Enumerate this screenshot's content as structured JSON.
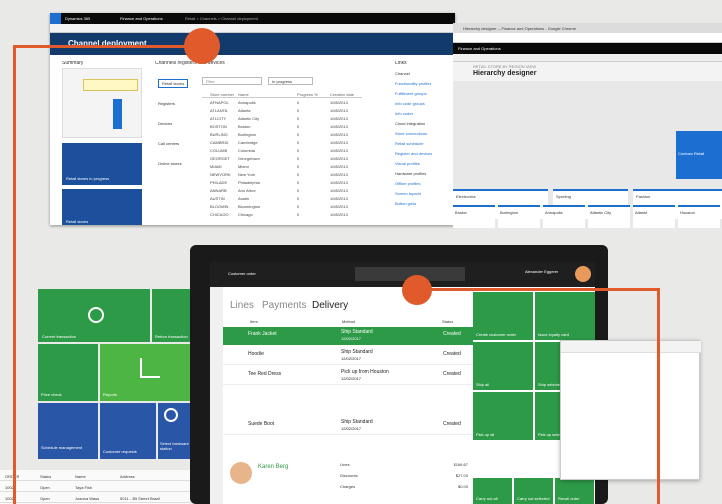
{
  "colors": {
    "accent": "#e15a2c",
    "green": "#2d9a47",
    "blue": "#1c4f9c",
    "navy": "#123a6b"
  },
  "dyn": {
    "app": "Dynamics 365",
    "module": "Finance and Operations",
    "crumb": "Retail > Channels > Channel deployment",
    "page_title": "Channel deployment",
    "summary": "Summary",
    "registers_title": "Channels registers and devices",
    "links": "Links",
    "tile1": "Retail stores in progress",
    "tile2": "Retail stores",
    "left_list": [
      "Retail stores",
      "Registers",
      "Devices",
      "Call centers",
      "Online stores"
    ],
    "filter": "Filter",
    "status": "In progress",
    "cols": [
      "Store number",
      "Name",
      "Progress %",
      "Creation date"
    ],
    "rows": [
      [
        "AFNAPOL",
        "Annapolis",
        "0",
        "10/8/2013"
      ],
      [
        "ATLANTA",
        "Atlanta",
        "0",
        "10/8/2013"
      ],
      [
        "ATLCITY",
        "Atlantic City",
        "0",
        "10/8/2013"
      ],
      [
        "BOSTON",
        "Boston",
        "0",
        "10/8/2013"
      ],
      [
        "BURLING",
        "Burlington",
        "0",
        "10/8/2013"
      ],
      [
        "CAMBRID",
        "Cambridge",
        "0",
        "10/8/2013"
      ],
      [
        "COLUMB",
        "Columbia",
        "0",
        "10/8/2013"
      ],
      [
        "GEORGET",
        "Georgetown",
        "0",
        "10/8/2013"
      ],
      [
        "MIAMI",
        "Miami",
        "0",
        "10/8/2013"
      ],
      [
        "NEWYORK",
        "New York",
        "0",
        "10/8/2013"
      ],
      [
        "PHILADE",
        "Philadelphia",
        "0",
        "10/8/2013"
      ],
      [
        "ANNARB",
        "Ann Arbor",
        "0",
        "10/8/2013"
      ],
      [
        "AUSTIN",
        "Austin",
        "0",
        "10/8/2013"
      ],
      [
        "BLOOMIN",
        "Bloomington",
        "0",
        "10/8/2013"
      ],
      [
        "CHICAGO",
        "Chicago",
        "0",
        "10/8/2013"
      ]
    ],
    "link_sections": [
      "Channel",
      "Functionality profiles",
      "Fulfillment groups",
      "Info code groups",
      "Info codes",
      "Cloud integration",
      "Store connections",
      "Retail scheduler",
      "Register and devices",
      "Visual profiles",
      "Hardware profiles",
      "Offline profiles",
      "Screen layouts",
      "Button grids"
    ]
  },
  "chr": {
    "tab": "Hierarchy designer -- Finance and Operations - Google Chrome",
    "app": "Finance and Operations",
    "heading_small": "RETAIL STORE BY REGION VIEW",
    "heading": "Hierarchy designer",
    "nodes_row1": [
      "Electronics",
      "Sporting",
      "Fashion"
    ],
    "nodes_row2": [
      "Boston",
      "Burlington",
      "Annapolis",
      "Atlantic City",
      "Atlanta",
      "Houston"
    ],
    "blue_node": "Contoso Retail"
  },
  "pos": {
    "t1": "Current transaction",
    "t2": "Return transaction",
    "t3": "Price check",
    "t4": "Reports",
    "t5": "Schedule management",
    "t6": "Customer requests",
    "t7": "Select hardware station"
  },
  "screen": {
    "title": "Customer order",
    "user": "Alexander Eggerer",
    "tabs": [
      "Lines",
      "Payments",
      "Delivery"
    ],
    "cols": [
      "Item",
      "Method",
      "Status"
    ],
    "lines": [
      {
        "item": "Frank Jacket",
        "method": "Ship Standard",
        "date": "12/02/2017",
        "status": "Created"
      },
      {
        "item": "Hoodie",
        "method": "Ship Standard",
        "date": "12/02/2017",
        "status": "Created"
      },
      {
        "item": "Tee Red Dress",
        "method": "Pick up from Houston",
        "date": "12/02/2017",
        "status": "Created"
      },
      {
        "item": "Suede Boot",
        "method": "Ship Standard",
        "date": "12/02/2017",
        "status": "Created"
      }
    ],
    "customer": "Karen Berg",
    "totals": [
      [
        "Lines",
        "",
        "$166.67"
      ],
      [
        "Discounts",
        "",
        "$27.00"
      ],
      [
        "Charges",
        "",
        "$0.00"
      ]
    ],
    "right_tiles": [
      "Create customer order",
      "Issue loyalty card",
      "Ship all",
      "Ship selected",
      "Pick up all",
      "Pick up selected",
      "Carry out all",
      "Carry out selected",
      "Recall order"
    ]
  },
  "bottom_rows": [
    [
      "ORDER",
      "Status",
      "Name",
      "Address"
    ],
    [
      "10025",
      "Open",
      "Taya Fish",
      ""
    ],
    [
      "10024",
      "Open",
      "Joanna Wass",
      "5011 - 3B Street Brazil"
    ]
  ]
}
